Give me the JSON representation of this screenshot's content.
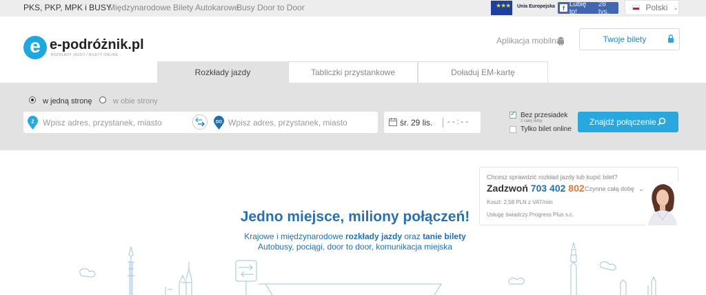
{
  "topbar": {
    "links": [
      "PKS, PKP, MPK i BUSY",
      "Międzynarodowe Bilety Autokarowe",
      "Busy Door to Door"
    ],
    "eu_label": "Unia Europejska",
    "fb_like": "Lubię to!",
    "fb_count": "28 tys.",
    "language": "Polski"
  },
  "header": {
    "logo_letter": "e",
    "logo_text": "e-podróżnik.pl",
    "logo_tagline": "ROZKŁADY JAZDY / BILETY ONLINE",
    "mobile_app": "Aplikacja mobilna",
    "tickets": "Twoje bilety"
  },
  "tabs": [
    "Rozkłady jazdy",
    "Tabliczki przystankowe",
    "Doładuj EM-kartę"
  ],
  "search": {
    "one_way": "w jedną stronę",
    "round_trip": "w obie strony",
    "from_badge": "Z",
    "from_placeholder": "Wpisz adres, przystanek, miasto",
    "to_badge": "DO",
    "to_placeholder": "Wpisz adres, przystanek, miasto",
    "date": "śr. 29 lis.",
    "time": "- - : - -",
    "direct_label": "Bez przesiadek",
    "direct_sub1": "z całej doby",
    "direct_sub2": "",
    "online_label": "Tylko bilet online",
    "find_button": "Znajdź połączenie"
  },
  "promo": {
    "question": "Chcesz sprawdzić rozkład jazdy lub kupić bilet?",
    "call": "Zadzwoń",
    "phone_a": "703 402",
    "phone_b": "802",
    "hours": "Czynne całą dobę",
    "cost": "Koszt: 2,58 PLN z VAT/min",
    "provider": "Usługę świadczy Progress Plus s.c."
  },
  "hero": {
    "title": "Jedno miejsce, miliony połączeń!",
    "line1_a": "Krajowe i międzynarodowe",
    "line1_b": "rozkłady jazdy",
    "line1_c": "oraz",
    "line1_d": "tanie bilety",
    "line2": "Autobusy, pociągi, door to door, komunikacja miejska"
  },
  "colors": {
    "accent": "#29a8e0",
    "brand_blue": "#1d6fb4",
    "orange": "#e07a33"
  }
}
